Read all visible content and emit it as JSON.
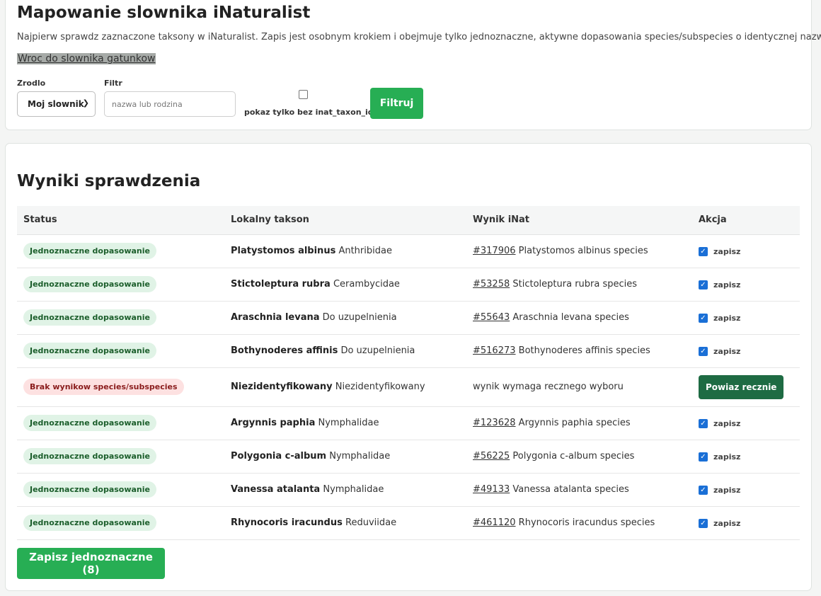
{
  "header": {
    "title": "Mapowanie slownika iNaturalist",
    "intro": "Najpierw sprawdz zaznaczone taksony w iNaturalist. Zapis jest osobnym krokiem i obejmuje tylko jednoznaczne, aktywne dopasowania species/subspecies o identycznej nazwie.",
    "back_link": "Wroc do slownika gatunkow"
  },
  "filters": {
    "source_label": "Zrodlo",
    "source_value": "Moj slownik",
    "filter_label": "Filtr",
    "filter_placeholder": "nazwa lub rodzina",
    "only_missing_label": "pokaz tylko bez inat_taxon_id",
    "submit_label": "Filtruj"
  },
  "results": {
    "title": "Wyniki sprawdzenia",
    "columns": [
      "Status",
      "Lokalny takson",
      "Wynik iNat",
      "Akcja"
    ],
    "save_label": "zapisz",
    "manual_label": "Powiaz recznie",
    "rows": [
      {
        "status": "Jednoznaczne dopasowanie",
        "name": "Platystomos albinus",
        "family": "Anthribidae",
        "inat_id": "#317906",
        "inat_text": "Platystomos albinus species"
      },
      {
        "status": "Jednoznaczne dopasowanie",
        "name": "Stictoleptura rubra",
        "family": "Cerambycidae",
        "inat_id": "#53258",
        "inat_text": "Stictoleptura rubra species"
      },
      {
        "status": "Jednoznaczne dopasowanie",
        "name": "Araschnia levana",
        "family": "Do uzupelnienia",
        "inat_id": "#55643",
        "inat_text": "Araschnia levana species"
      },
      {
        "status": "Jednoznaczne dopasowanie",
        "name": "Bothynoderes affinis",
        "family": "Do uzupelnienia",
        "inat_id": "#516273",
        "inat_text": "Bothynoderes affinis species"
      },
      {
        "status": "Brak wynikow species/subspecies",
        "name": "Niezidentyfikowany",
        "family": "Niezidentyfikowany",
        "inat_id": "",
        "inat_text": "wynik wymaga recznego wyboru"
      },
      {
        "status": "Jednoznaczne dopasowanie",
        "name": "Argynnis paphia",
        "family": "Nymphalidae",
        "inat_id": "#123628",
        "inat_text": "Argynnis paphia species"
      },
      {
        "status": "Jednoznaczne dopasowanie",
        "name": "Polygonia c-album",
        "family": "Nymphalidae",
        "inat_id": "#56225",
        "inat_text": "Polygonia c-album species"
      },
      {
        "status": "Jednoznaczne dopasowanie",
        "name": "Vanessa atalanta",
        "family": "Nymphalidae",
        "inat_id": "#49133",
        "inat_text": "Vanessa atalanta species"
      },
      {
        "status": "Jednoznaczne dopasowanie",
        "name": "Rhynocoris iracundus",
        "family": "Reduviidae",
        "inat_id": "#461120",
        "inat_text": "Rhynocoris iracundus species"
      }
    ],
    "save_all_label": "Zapisz jednoznaczne (8)"
  }
}
